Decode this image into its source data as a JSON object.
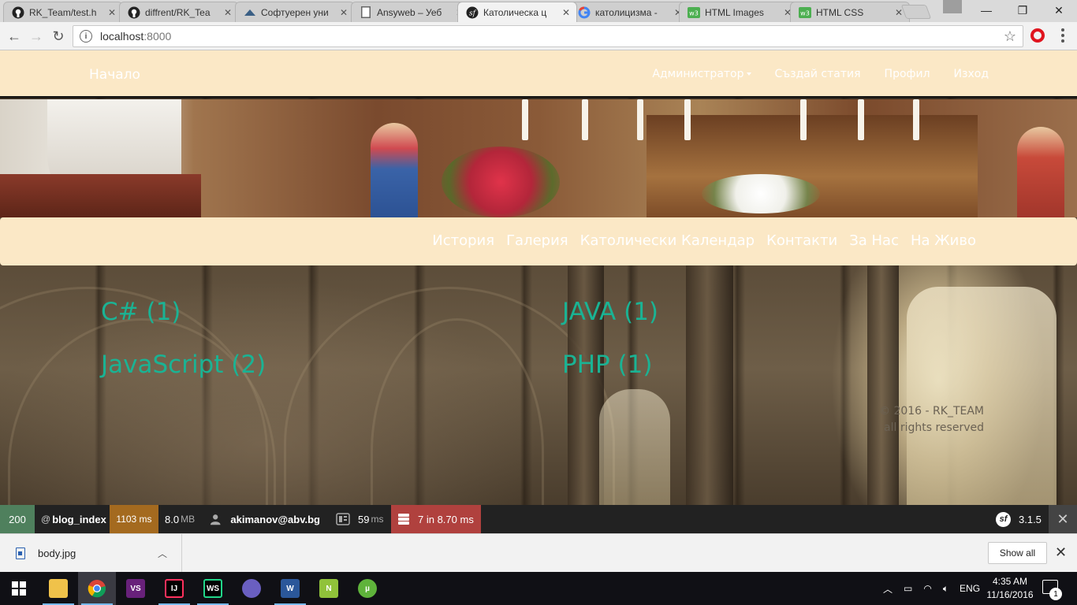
{
  "browser": {
    "tabs": [
      {
        "title": "RK_Team/test.h",
        "icon": "github-icon"
      },
      {
        "title": "diffrent/RK_Tea",
        "icon": "github-icon"
      },
      {
        "title": "Софтуерен уни",
        "icon": "softuni-icon"
      },
      {
        "title": "Ansyweb – Уеб",
        "icon": "document-icon"
      },
      {
        "title": "Католическа ц",
        "icon": "symfony-icon"
      },
      {
        "title": "католицизма -",
        "icon": "google-icon"
      },
      {
        "title": "HTML Images",
        "icon": "w3schools-icon"
      },
      {
        "title": "HTML CSS",
        "icon": "w3schools-icon"
      }
    ],
    "active_tab_index": 4,
    "url_host": "localhost",
    "url_port": ":8000"
  },
  "site": {
    "brand": "Начало",
    "top_links": [
      "Администратор",
      "Създай статия",
      "Профил",
      "Изход"
    ],
    "sub_links": [
      "История",
      "Галерия",
      "Католически Календар",
      "Контакти",
      "За Нас",
      "На Живо"
    ],
    "categories": [
      "C# (1)",
      "JAVA (1)",
      "JavaScript (2)",
      "PHP (1)"
    ],
    "footer_line1": "© 2016 - RK_TEAM",
    "footer_line2": "all rights reserved"
  },
  "debug_toolbar": {
    "status_code": "200",
    "route_prefix": "@",
    "route": "blog_index",
    "time": "1103 ms",
    "memory_value": "8.0",
    "memory_unit": "MB",
    "user": "akimanov@abv.bg",
    "forms_value": "59",
    "forms_unit": "ms",
    "db": "7 in 8.70 ms",
    "version": "3.1.5",
    "colors": {
      "status": "#4f805d",
      "time": "#a46a1f",
      "db": "#b0413e"
    }
  },
  "downloads": {
    "file": "body.jpg",
    "show_all": "Show all"
  },
  "taskbar": {
    "apps": [
      "file-explorer-icon",
      "chrome-icon",
      "visual-studio-icon",
      "intellij-icon",
      "webstorm-icon",
      "app-icon",
      "word-icon",
      "notepad-plus-plus-icon",
      "utorrent-icon"
    ],
    "language": "ENG",
    "time": "4:35 AM",
    "date": "11/16/2016",
    "notifications": "1"
  }
}
